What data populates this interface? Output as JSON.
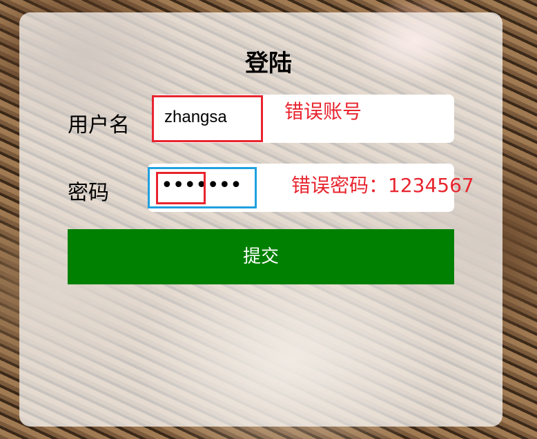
{
  "form": {
    "title": "登陆",
    "username_label": "用户名",
    "username_value": "zhangsa",
    "password_label": "密码",
    "password_masked": "•••••••",
    "submit_label": "提交"
  },
  "annotations": {
    "wrong_account": "错误账号",
    "wrong_password": "错误密码：1234567"
  },
  "colors": {
    "submit_bg": "#008000",
    "annotation_red": "#e8242e",
    "focus_blue": "#1ea0e0"
  }
}
